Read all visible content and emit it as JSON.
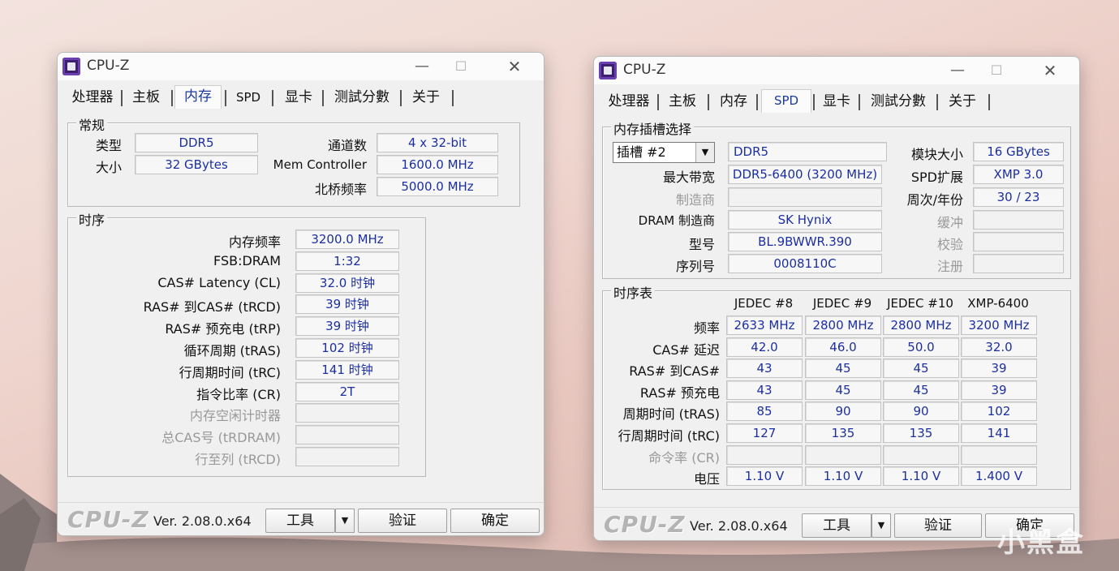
{
  "left": {
    "title": "CPU-Z",
    "tabs": [
      "处理器",
      "主板",
      "内存",
      "SPD",
      "显卡",
      "测試分數",
      "关于"
    ],
    "general": {
      "title": "常规",
      "type_label": "类型",
      "type_value": "DDR5",
      "size_label": "大小",
      "size_value": "32 GBytes",
      "channels_label": "通道数",
      "channels_value": "4 x 32-bit",
      "memctrl_label": "Mem Controller",
      "memctrl_value": "1600.0 MHz",
      "nb_label": "北桥频率",
      "nb_value": "5000.0 MHz"
    },
    "timings": {
      "title": "时序",
      "rows": [
        {
          "label": "内存频率",
          "value": "3200.0 MHz",
          "dim": false
        },
        {
          "label": "FSB:DRAM",
          "value": "1:32",
          "dim": false
        },
        {
          "label": "CAS# Latency (CL)",
          "value": "32.0 时钟",
          "dim": false
        },
        {
          "label": "RAS# 到CAS# (tRCD)",
          "value": "39 时钟",
          "dim": false
        },
        {
          "label": "RAS# 预充电 (tRP)",
          "value": "39 时钟",
          "dim": false
        },
        {
          "label": "循环周期 (tRAS)",
          "value": "102 时钟",
          "dim": false
        },
        {
          "label": "行周期时间 (tRC)",
          "value": "141 时钟",
          "dim": false
        },
        {
          "label": "指令比率 (CR)",
          "value": "2T",
          "dim": false
        },
        {
          "label": "内存空闲计时器",
          "value": "",
          "dim": true
        },
        {
          "label": "总CAS号 (tRDRAM)",
          "value": "",
          "dim": true
        },
        {
          "label": "行至列 (tRCD)",
          "value": "",
          "dim": true
        }
      ]
    },
    "footer": {
      "brand": "CPU-Z",
      "version": "Ver. 2.08.0.x64",
      "tools": "工具",
      "validate": "验证",
      "ok": "确定"
    }
  },
  "right": {
    "title": "CPU-Z",
    "tabs": [
      "处理器",
      "主板",
      "内存",
      "SPD",
      "显卡",
      "测試分數",
      "关于"
    ],
    "slot": {
      "title": "内存插槽选择",
      "slot_selected": "插槽 #2",
      "type_value": "DDR5",
      "module_size_label": "模块大小",
      "module_size_value": "16 GBytes",
      "max_bw_label": "最大带宽",
      "max_bw_value": "DDR5-6400 (3200 MHz)",
      "spd_ext_label": "SPD扩展",
      "spd_ext_value": "XMP 3.0",
      "mfr_label": "制造商",
      "mfr_value": "",
      "week_year_label": "周次/年份",
      "week_year_value": "30 / 23",
      "dram_mfr_label": "DRAM 制造商",
      "dram_mfr_value": "SK Hynix",
      "buffered_label": "缓冲",
      "buffered_value": "",
      "part_label": "型号",
      "part_value": "BL.9BWWR.390",
      "check_label": "校验",
      "check_value": "",
      "serial_label": "序列号",
      "serial_value": "0008110C",
      "reg_label": "注册",
      "reg_value": ""
    },
    "timing_table": {
      "title": "时序表",
      "columns": [
        "JEDEC #8",
        "JEDEC #9",
        "JEDEC #10",
        "XMP-6400"
      ],
      "rows": [
        {
          "label": "频率",
          "values": [
            "2633 MHz",
            "2800 MHz",
            "2800 MHz",
            "3200 MHz"
          ],
          "dim": false
        },
        {
          "label": "CAS# 延迟",
          "values": [
            "42.0",
            "46.0",
            "50.0",
            "32.0"
          ],
          "dim": false
        },
        {
          "label": "RAS# 到CAS#",
          "values": [
            "43",
            "45",
            "45",
            "39"
          ],
          "dim": false
        },
        {
          "label": "RAS# 预充电",
          "values": [
            "43",
            "45",
            "45",
            "39"
          ],
          "dim": false
        },
        {
          "label": "周期时间 (tRAS)",
          "values": [
            "85",
            "90",
            "90",
            "102"
          ],
          "dim": false
        },
        {
          "label": "行周期时间 (tRC)",
          "values": [
            "127",
            "135",
            "135",
            "141"
          ],
          "dim": false
        },
        {
          "label": "命令率 (CR)",
          "values": [
            "",
            "",
            "",
            ""
          ],
          "dim": true
        },
        {
          "label": "电压",
          "values": [
            "1.10 V",
            "1.10 V",
            "1.10 V",
            "1.400 V"
          ],
          "dim": false
        }
      ]
    },
    "footer": {
      "brand": "CPU-Z",
      "version": "Ver. 2.08.0.x64",
      "tools": "工具",
      "validate": "验证",
      "ok": "确定"
    }
  },
  "watermark": "小黑盒"
}
